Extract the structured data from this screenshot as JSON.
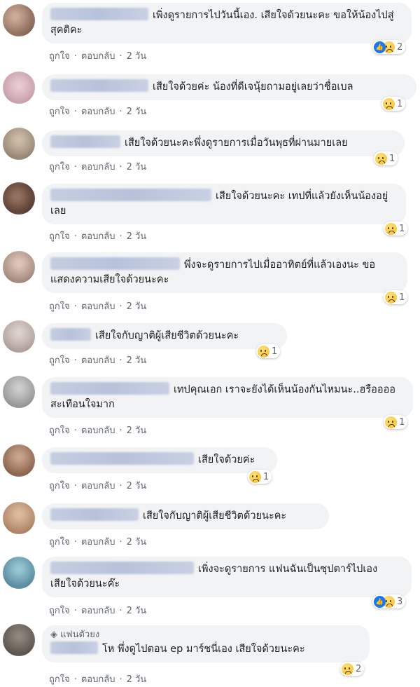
{
  "comments": [
    {
      "text": "เพิ่งดูรายการไปวันนี้เอง. เสียใจด้วยนะคะ ขอให้น้องไปสู่สุคติคะ",
      "like": "ถูกใจ",
      "reply": "ตอบกลับ",
      "time": "2 วัน",
      "reactions": "2",
      "has_like": true
    },
    {
      "text": "เสียใจด้วยค่ะ น้องที่ดีเจนุ้ยถามอยู่เลยว่าชื่อเบล",
      "like": "ถูกใจ",
      "reply": "ตอบกลับ",
      "time": "2 วัน",
      "reactions": "1",
      "has_like": false
    },
    {
      "text": "เสียใจด้วยนะคะพึ่งดูรายการเมื่อวันพุธที่ผ่านมายเลย",
      "like": "ถูกใจ",
      "reply": "ตอบกลับ",
      "time": "2 วัน",
      "reactions": "1",
      "has_like": false
    },
    {
      "text": "เสียใจด้วยนะคะ เทปที่แล้วยังเห็นน้องอยู่เลย",
      "like": "ถูกใจ",
      "reply": "ตอบกลับ",
      "time": "2 วัน",
      "reactions": "1",
      "has_like": false
    },
    {
      "text": "พึ่งจะดูรายการไปเมื่ออาทิตย์ที่แล้วเองนะ ขอแสดงความเสียใจด้วยนะคะ",
      "like": "ถูกใจ",
      "reply": "ตอบกลับ",
      "time": "2 วัน",
      "reactions": "1",
      "has_like": false
    },
    {
      "text": "เสียใจกับญาติผู้เสียชีวิตด้วยนะคะ",
      "like": "ถูกใจ",
      "reply": "ตอบกลับ",
      "time": "2 วัน",
      "reactions": "1",
      "has_like": false
    },
    {
      "text": "เทปคุณเอก เราจะยังได้เห็นน้องกันไหมนะ..ฮรืออออ สะเทือนใจมาก",
      "like": "ถูกใจ",
      "reply": "ตอบกลับ",
      "time": "2 วัน",
      "reactions": "1",
      "has_like": false
    },
    {
      "text": "เสียใจด้วยค่ะ",
      "like": "ถูกใจ",
      "reply": "ตอบกลับ",
      "time": "2 วัน",
      "reactions": "1",
      "has_like": false
    },
    {
      "text": "เสียใจกับญาติผู้เสียชีวิตด้วยนะคะ",
      "like": "ถูกใจ",
      "reply": "ตอบกลับ",
      "time": "2 วัน",
      "reactions": "",
      "has_like": false
    },
    {
      "text": "เพิ่งจะดูรายการ แฟนฉันเป็นซุปตาร์ไปเอง เสียใจด้วยนะค๊ะ",
      "like": "ถูกใจ",
      "reply": "ตอบกลับ",
      "time": "2 วัน",
      "reactions": "3",
      "has_like": true
    },
    {
      "badge": "แฟนตัวยง",
      "text": "โห พึ่งดูไปตอน ep มาร์ชนี่เอง เสียใจด้วยนะคะ",
      "like": "ถูกใจ",
      "reply": "ตอบกลับ",
      "time": "2 วัน",
      "reactions": "2",
      "has_like": false
    }
  ],
  "colors": {
    "bubble": "#f2f3f5",
    "meta": "#606770",
    "like_blue": "#1877f2",
    "sad_yellow": "#f7b928"
  },
  "icons": {
    "sad": "sad-reaction-icon",
    "like": "like-reaction-icon",
    "badge": "diamond-icon"
  }
}
